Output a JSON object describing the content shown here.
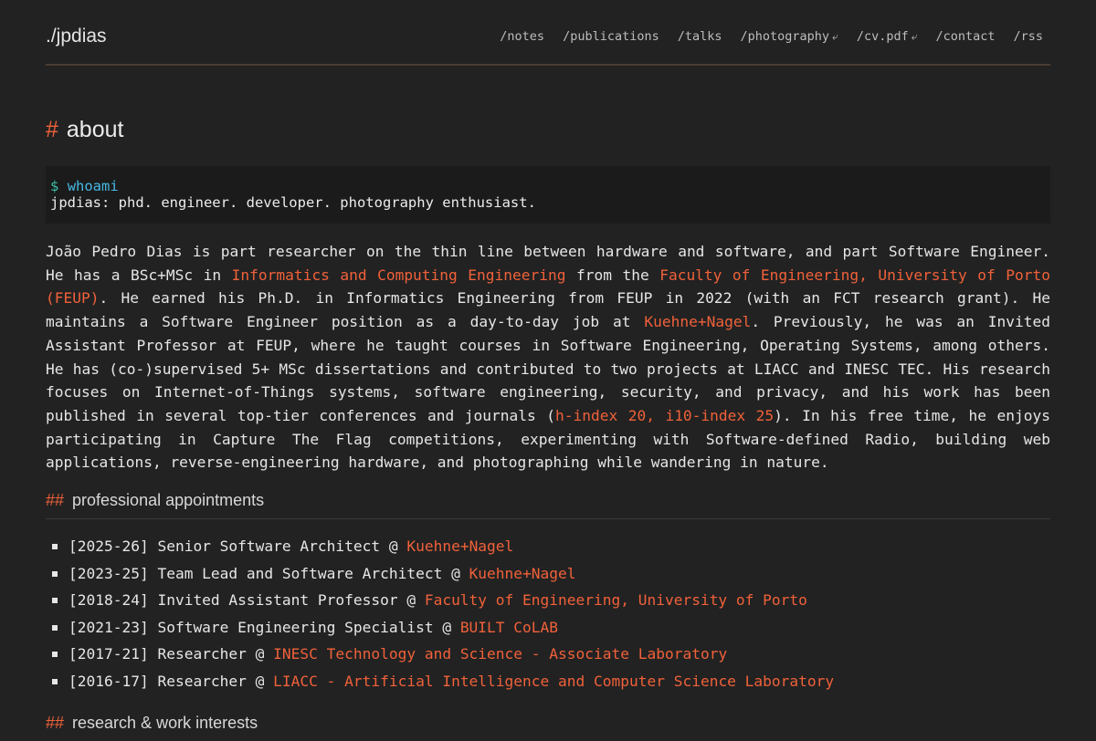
{
  "header": {
    "title": "./jpdias",
    "nav": [
      {
        "label": "/notes",
        "external": false
      },
      {
        "label": "/publications",
        "external": false
      },
      {
        "label": "/talks",
        "external": false
      },
      {
        "label": "/photography",
        "external": true
      },
      {
        "label": "/cv.pdf",
        "external": true
      },
      {
        "label": "/contact",
        "external": false
      },
      {
        "label": "/rss",
        "external": false
      }
    ],
    "external_glyph": "⤶"
  },
  "about": {
    "hash": "#",
    "heading": "about",
    "terminal": {
      "prompt": "$",
      "command": "whoami",
      "output": "jpdias: phd. engineer. developer. photography enthusiast."
    },
    "bio": {
      "t1": "João Pedro Dias is part researcher on the thin line between hardware and software, and part Software Engineer. He has a BSc+MSc in ",
      "l1": "Informatics and Computing Engineering",
      "t2": " from the ",
      "l2": "Faculty of Engineering, University of Porto (FEUP)",
      "t3": ". He earned his Ph.D. in Informatics Engineering from FEUP in 2022 (with an FCT research grant). He maintains a Software Engineer position as a day-to-day job at ",
      "l3": "Kuehne+Nagel",
      "t4": ". Previously, he was an Invited Assistant Professor at FEUP, where he taught courses in Software Engineering, Operating Systems, among others. He has (co-)supervised 5+ MSc dissertations and contributed to two projects at LIACC and INESC TEC. His research focuses on Internet-of-Things systems, software engineering, security, and privacy, and his work has been published in several top-tier conferences and journals (",
      "l4": "h-index 20, i10-index 25",
      "t5": "). In his free time, he enjoys participating in Capture The Flag competitions, experimenting with Software-defined Radio, building web applications, reverse-engineering hardware, and photographing while wandering in nature."
    }
  },
  "appointments": {
    "hash": "##",
    "heading": "professional appointments",
    "items": [
      {
        "text": "[2025-26] Senior Software Architect @ ",
        "org": "Kuehne+Nagel"
      },
      {
        "text": "[2023-25] Team Lead and Software Architect @ ",
        "org": "Kuehne+Nagel"
      },
      {
        "text": "[2018-24] Invited Assistant Professor @ ",
        "org": "Faculty of Engineering, University of Porto"
      },
      {
        "text": "[2021-23] Software Engineering Specialist @ ",
        "org": "BUILT CoLAB"
      },
      {
        "text": "[2017-21] Researcher @ ",
        "org": "INESC Technology and Science - Associate Laboratory"
      },
      {
        "text": "[2016-17] Researcher @ ",
        "org": "LIACC - Artificial Intelligence and Computer Science Laboratory"
      }
    ]
  },
  "interests": {
    "hash": "##",
    "heading": "research & work interests"
  },
  "colors": {
    "background": "#222222",
    "accent": "#f0613a",
    "prompt": "#3bbfa5",
    "command": "#47b9e4",
    "terminal_bg": "#1b1b1b"
  }
}
